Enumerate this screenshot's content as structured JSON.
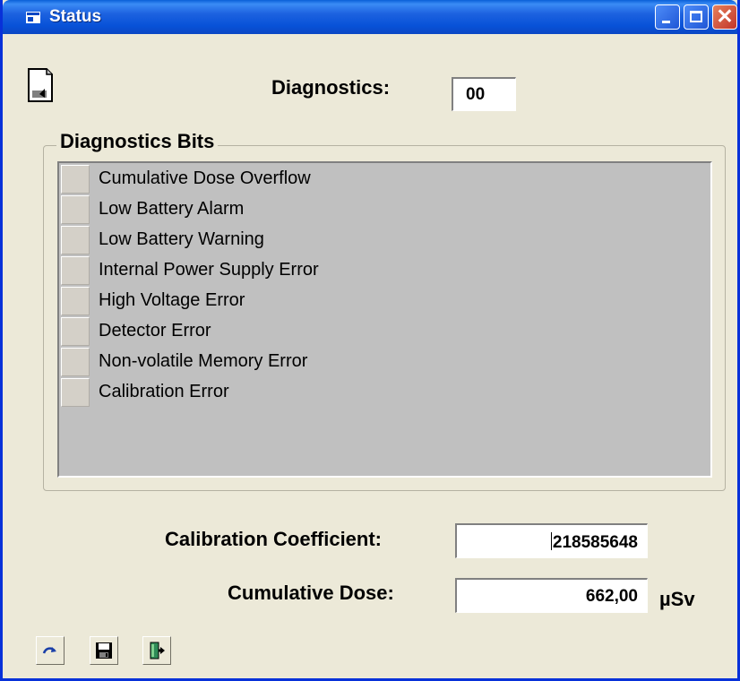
{
  "window": {
    "title": "Status",
    "title_icon": "window-icon"
  },
  "diagnostics": {
    "label": "Diagnostics:",
    "value": "00"
  },
  "bits_group": {
    "legend": "Diagnostics Bits",
    "items": [
      {
        "label": "Cumulative Dose Overflow"
      },
      {
        "label": "Low Battery Alarm"
      },
      {
        "label": "Low Battery Warning"
      },
      {
        "label": "Internal Power Supply Error"
      },
      {
        "label": "High Voltage Error"
      },
      {
        "label": "Detector Error"
      },
      {
        "label": "Non-volatile Memory Error"
      },
      {
        "label": "Calibration Error"
      }
    ]
  },
  "calibration": {
    "label": "Calibration Coefficient:",
    "value": "218585648"
  },
  "dose": {
    "label": "Cumulative Dose:",
    "value": "662,00",
    "unit": "µSv"
  },
  "toolbar": {
    "icons": [
      "refresh-icon",
      "save-icon",
      "exit-icon"
    ]
  },
  "colors": {
    "titlebar": "#0852d8",
    "panel": "#ece9d8",
    "list_bg": "#c0c0c0",
    "close": "#c2352b"
  }
}
